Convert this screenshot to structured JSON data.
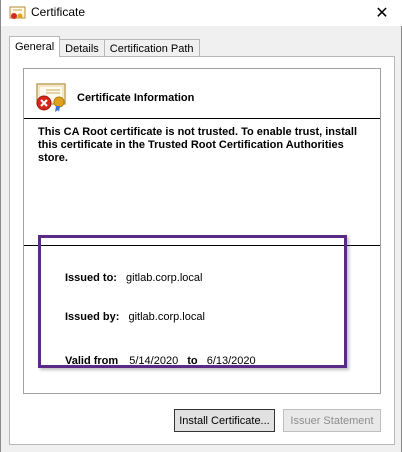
{
  "window": {
    "title": "Certificate",
    "close_glyph": "✕"
  },
  "tabs": [
    {
      "label": "General",
      "active": true
    },
    {
      "label": "Details",
      "active": false
    },
    {
      "label": "Certification Path",
      "active": false
    }
  ],
  "info": {
    "title": "Certificate Information",
    "warning": "This CA Root certificate is not trusted. To enable trust, install this certificate in the Trusted Root Certification Authorities store.",
    "issued_to_label": "Issued to:",
    "issued_to_value": "gitlab.corp.local",
    "issued_by_label": "Issued by:",
    "issued_by_value": "gitlab.corp.local",
    "valid_from_label": "Valid from",
    "valid_from_value": "5/14/2020",
    "valid_to_label": "to",
    "valid_to_value": "6/13/2020"
  },
  "buttons": {
    "install": "Install Certificate...",
    "issuer_statement": "Issuer Statement"
  },
  "colors": {
    "highlight_border": "#5b2a86",
    "error_red": "#d9261c",
    "seal_gold": "#e0a21a"
  },
  "icons": [
    "certificate-icon",
    "certificate-error-icon",
    "close-icon"
  ]
}
